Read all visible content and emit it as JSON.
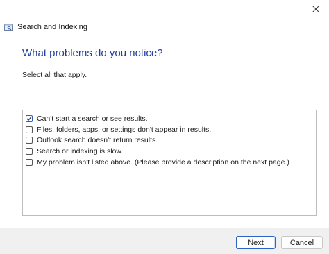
{
  "window": {
    "app_title": "Search and Indexing",
    "app_icon": "search-indexing-icon",
    "close_icon": "close-icon"
  },
  "main": {
    "heading": "What problems do you notice?",
    "instruction": "Select all that apply.",
    "options": [
      {
        "label": "Can't start a search or see results.",
        "checked": true
      },
      {
        "label": "Files, folders, apps, or settings don't appear in results.",
        "checked": false
      },
      {
        "label": "Outlook search doesn't return results.",
        "checked": false
      },
      {
        "label": "Search or indexing is slow.",
        "checked": false
      },
      {
        "label": "My problem isn't listed above. (Please provide a description on the next page.)",
        "checked": false
      }
    ]
  },
  "footer": {
    "next_label": "Next",
    "cancel_label": "Cancel"
  },
  "colors": {
    "heading": "#1f3e9a",
    "primary_button_border": "#2b63c6"
  }
}
